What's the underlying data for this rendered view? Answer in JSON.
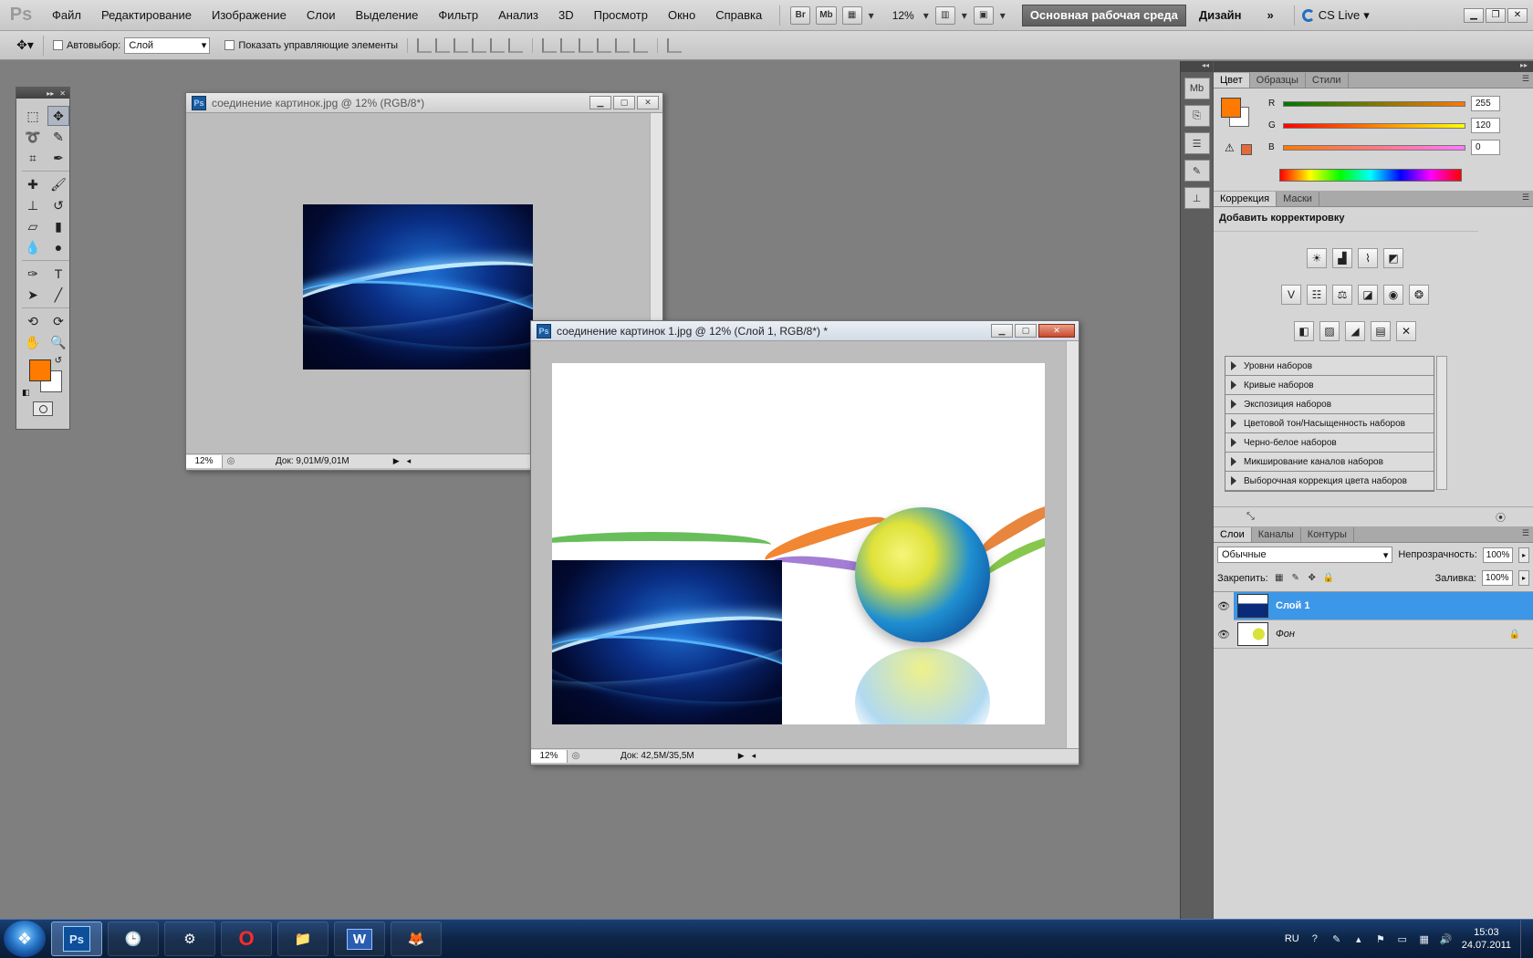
{
  "app": {
    "logo": "Ps",
    "menu": [
      "Файл",
      "Редактирование",
      "Изображение",
      "Слои",
      "Выделение",
      "Фильтр",
      "Анализ",
      "3D",
      "Просмотр",
      "Окно",
      "Справка"
    ],
    "bridge": "Br",
    "minibridge": "Mb",
    "zoom": "12%",
    "workspace_active": "Основная рабочая среда",
    "workspace_other": "Дизайн",
    "more": "»",
    "cs_live": "CS Live"
  },
  "options": {
    "autoselect_label": "Автовыбор:",
    "autoselect_value": "Слой",
    "show_controls_label": "Показать управляющие элементы"
  },
  "doc1": {
    "title": "соединение картинок.jpg @ 12% (RGB/8*)",
    "zoom": "12%",
    "doc_size": "Док: 9,01M/9,01M"
  },
  "doc2": {
    "title": "соединение картинок 1.jpg @ 12% (Слой 1, RGB/8*) *",
    "zoom": "12%",
    "doc_size": "Док: 42,5M/35,5M"
  },
  "color_panel": {
    "tabs": [
      "Цвет",
      "Образцы",
      "Стили"
    ],
    "r_label": "R",
    "g_label": "G",
    "b_label": "B",
    "r": "255",
    "g": "120",
    "b": "0",
    "fg_color": "#ff7a00"
  },
  "adjustments": {
    "tabs": [
      "Коррекция",
      "Маски"
    ],
    "title": "Добавить корректировку",
    "presets": [
      "Уровни наборов",
      "Кривые наборов",
      "Экспозиция наборов",
      "Цветовой тон/Насыщенность наборов",
      "Черно-белое наборов",
      "Микширование каналов наборов",
      "Выборочная коррекция цвета наборов"
    ]
  },
  "layers": {
    "tabs": [
      "Слои",
      "Каналы",
      "Контуры"
    ],
    "blend_mode": "Обычные",
    "opacity_label": "Непрозрачность:",
    "opacity": "100%",
    "lock_label": "Закрепить:",
    "fill_label": "Заливка:",
    "fill": "100%",
    "items": [
      {
        "name": "Слой 1"
      },
      {
        "name": "Фон"
      }
    ]
  },
  "taskbar": {
    "lang": "RU",
    "time": "15:03",
    "date": "24.07.2011",
    "ps_label": "Ps",
    "word_label": "W"
  }
}
